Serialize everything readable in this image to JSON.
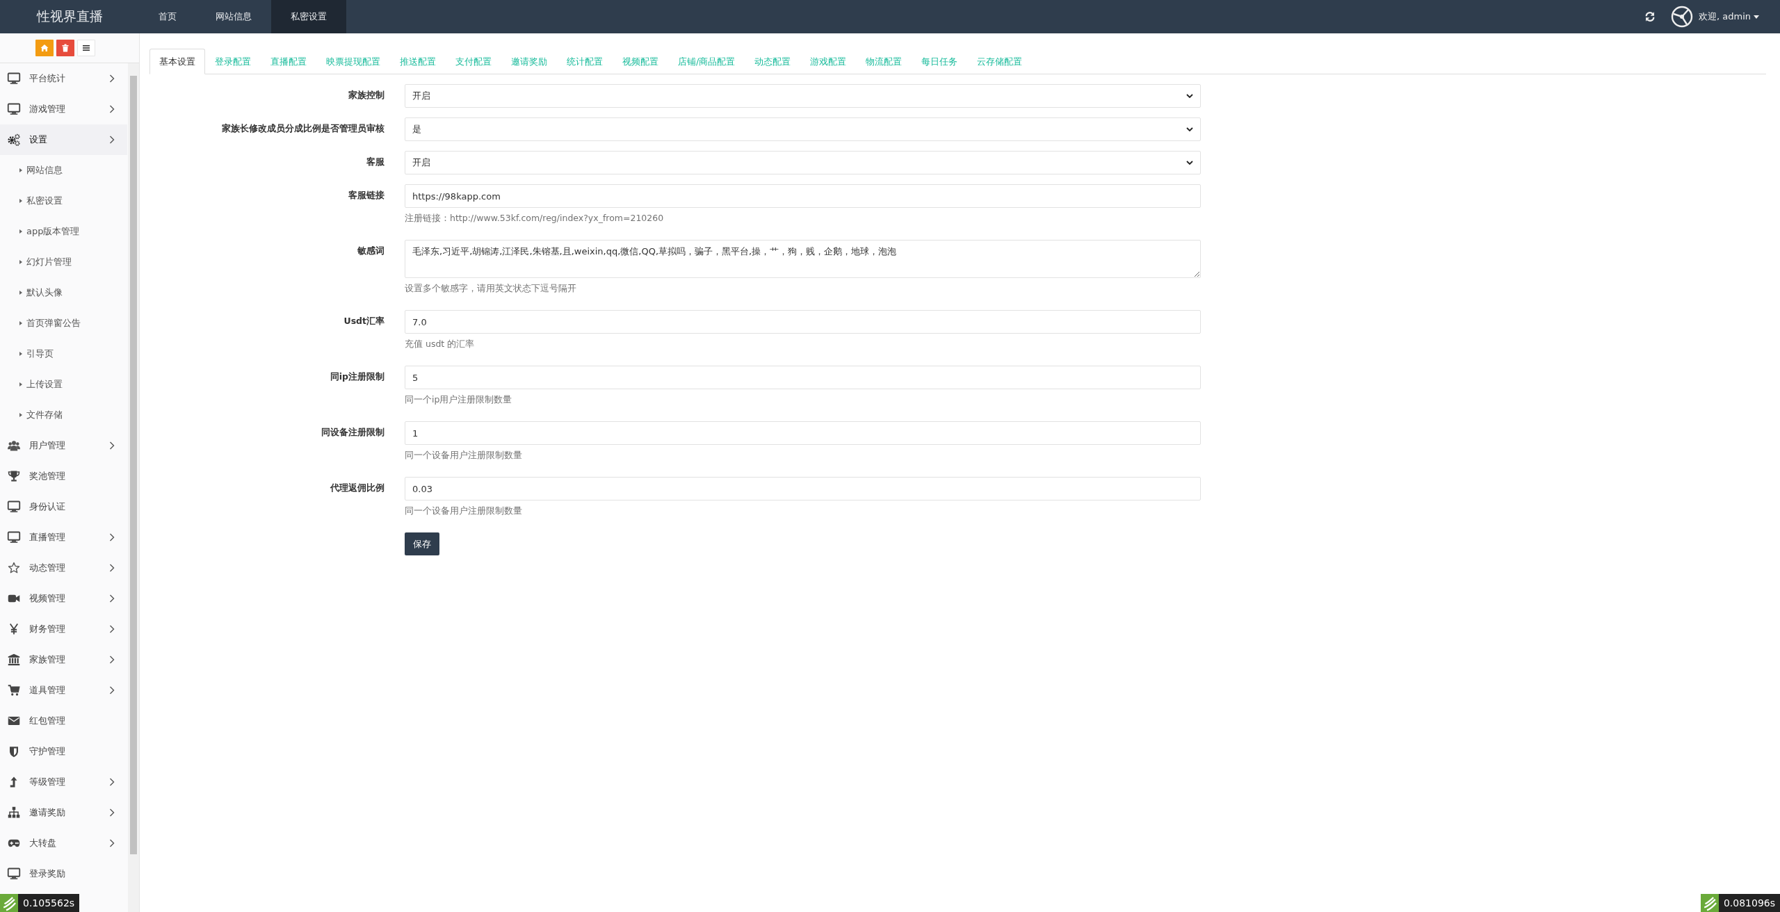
{
  "top_bar": {
    "brand": "性视界直播",
    "nav": [
      {
        "label": "首页",
        "selected": false
      },
      {
        "label": "网站信息",
        "selected": false
      },
      {
        "label": "私密设置",
        "selected": true
      }
    ],
    "user": "欢迎, admin"
  },
  "sidebar": {
    "items": [
      {
        "label": "平台统计",
        "expandable": true,
        "expanded": false
      },
      {
        "label": "游戏管理",
        "expandable": true,
        "expanded": false
      },
      {
        "label": "设置",
        "expandable": true,
        "expanded": true,
        "children": [
          {
            "label": "网站信息"
          },
          {
            "label": "私密设置"
          },
          {
            "label": "app版本管理"
          },
          {
            "label": "幻灯片管理"
          },
          {
            "label": "默认头像"
          },
          {
            "label": "首页弹窗公告"
          },
          {
            "label": "引导页"
          },
          {
            "label": "上传设置"
          },
          {
            "label": "文件存储"
          }
        ]
      },
      {
        "label": "用户管理",
        "expandable": true,
        "expanded": false
      },
      {
        "label": "奖池管理",
        "expandable": false,
        "expanded": false
      },
      {
        "label": "身份认证",
        "expandable": false,
        "expanded": false
      },
      {
        "label": "直播管理",
        "expandable": true,
        "expanded": false
      },
      {
        "label": "动态管理",
        "expandable": true,
        "expanded": false
      },
      {
        "label": "视频管理",
        "expandable": true,
        "expanded": false
      },
      {
        "label": "财务管理",
        "expandable": true,
        "expanded": false
      },
      {
        "label": "家族管理",
        "expandable": true,
        "expanded": false
      },
      {
        "label": "道具管理",
        "expandable": true,
        "expanded": false
      },
      {
        "label": "红包管理",
        "expandable": false,
        "expanded": false
      },
      {
        "label": "守护管理",
        "expandable": false,
        "expanded": false
      },
      {
        "label": "等级管理",
        "expandable": true,
        "expanded": false
      },
      {
        "label": "邀请奖励",
        "expandable": true,
        "expanded": false
      },
      {
        "label": "大转盘",
        "expandable": true,
        "expanded": false
      },
      {
        "label": "登录奖励",
        "expandable": false,
        "expanded": false
      }
    ]
  },
  "tabs": [
    {
      "label": "基本设置",
      "selected": true
    },
    {
      "label": "登录配置",
      "selected": false
    },
    {
      "label": "直播配置",
      "selected": false
    },
    {
      "label": "映票提现配置",
      "selected": false
    },
    {
      "label": "推送配置",
      "selected": false
    },
    {
      "label": "支付配置",
      "selected": false
    },
    {
      "label": "邀请奖励",
      "selected": false
    },
    {
      "label": "统计配置",
      "selected": false
    },
    {
      "label": "视频配置",
      "selected": false
    },
    {
      "label": "店铺/商品配置",
      "selected": false
    },
    {
      "label": "动态配置",
      "selected": false
    },
    {
      "label": "游戏配置",
      "selected": false
    },
    {
      "label": "物流配置",
      "selected": false
    },
    {
      "label": "每日任务",
      "selected": false
    },
    {
      "label": "云存储配置",
      "selected": false
    }
  ],
  "form": {
    "fields": [
      {
        "label": "家族控制",
        "kind": "select",
        "value": "开启"
      },
      {
        "label": "家族长修改成员分成比例是否管理员审核",
        "kind": "select",
        "value": "是"
      },
      {
        "label": "客服",
        "kind": "select",
        "value": "开启"
      },
      {
        "label": "客服链接",
        "kind": "input",
        "value": "https://98kapp.com",
        "help": "注册链接：http://www.53kf.com/reg/index?yx_from=210260"
      },
      {
        "label": "敏感词",
        "kind": "textarea",
        "value": "毛泽东,习近平,胡锦涛,江泽民,朱镕基,且,weixin,qq,微信,QQ,草拟吗，骗子，黑平台,操，艹，狗，贱，企鹅，地球，泡泡",
        "help": "设置多个敏感字，请用英文状态下逗号隔开"
      },
      {
        "label": "Usdt汇率",
        "kind": "input",
        "value": "7.0",
        "help": "充值 usdt 的汇率"
      },
      {
        "label": "同ip注册限制",
        "kind": "input",
        "value": "5",
        "help": "同一个ip用户注册限制数量"
      },
      {
        "label": "同设备注册限制",
        "kind": "input",
        "value": "1",
        "help": "同一个设备用户注册限制数量"
      },
      {
        "label": "代理返佣比例",
        "kind": "input",
        "value": "0.03",
        "help": "同一个设备用户注册限制数量"
      }
    ],
    "save_button": "保存"
  },
  "timings": [
    "0.105562s",
    "0.081096s"
  ]
}
